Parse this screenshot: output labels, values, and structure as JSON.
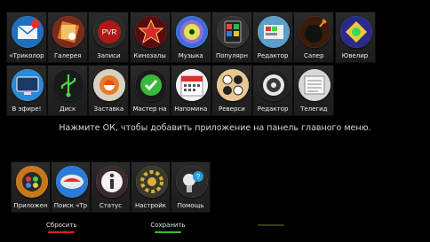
{
  "apps_row_1": [
    {
      "label": "«Триколор",
      "icon": "mail-icon"
    },
    {
      "label": "Галерея",
      "icon": "gallery-icon"
    },
    {
      "label": "Записи",
      "icon": "pvr-icon",
      "icon_text": "PVR"
    },
    {
      "label": "Кинозалы",
      "icon": "film-star-icon"
    },
    {
      "label": "Музыка",
      "icon": "music-icon"
    },
    {
      "label": "Популярн",
      "icon": "popular-apps-icon"
    },
    {
      "label": "Редактор",
      "icon": "editor-icon"
    },
    {
      "label": "Сапер",
      "icon": "minesweeper-icon"
    },
    {
      "label": "Ювелир",
      "icon": "jeweler-icon"
    }
  ],
  "apps_row_2": [
    {
      "label": "В эфире!",
      "icon": "on-air-icon"
    },
    {
      "label": "Диск",
      "icon": "usb-disk-icon"
    },
    {
      "label": "Заставка",
      "icon": "screensaver-icon"
    },
    {
      "label": "Мастер на",
      "icon": "setup-wizard-icon"
    },
    {
      "label": "Напомина",
      "icon": "calendar-icon"
    },
    {
      "label": "Реверси",
      "icon": "reversi-icon"
    },
    {
      "label": "Редактор",
      "icon": "editor-2-icon"
    },
    {
      "label": "Телегид",
      "icon": "tv-guide-icon"
    }
  ],
  "hint_text": "Нажмите ОК, чтобы добавить приложение на панель главного меню.",
  "main_menu_panel": [
    {
      "label": "Приложен",
      "icon": "apps-icon"
    },
    {
      "label": "Поиск «Тр",
      "icon": "search-icon"
    },
    {
      "label": "Статус",
      "icon": "info-icon"
    },
    {
      "label": "Настройк",
      "icon": "settings-icon"
    },
    {
      "label": "Помощь",
      "icon": "help-icon"
    }
  ],
  "actions": {
    "reset": {
      "label": "Сбросить",
      "color": "#e0201c"
    },
    "save": {
      "label": "Сохранить",
      "color": "#2fbf2f"
    },
    "third": {
      "label": "",
      "color": "#3a3a10"
    }
  }
}
